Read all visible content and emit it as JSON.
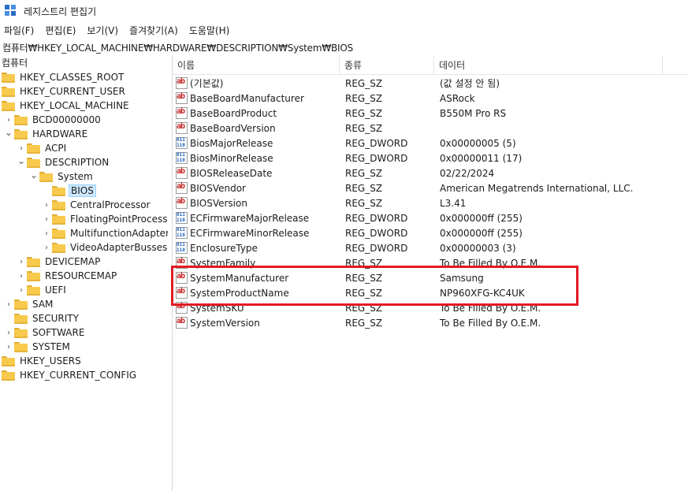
{
  "window": {
    "title": "레지스트리 편집기"
  },
  "menu": [
    "파일(F)",
    "편집(E)",
    "보기(V)",
    "즐겨찾기(A)",
    "도움말(H)"
  ],
  "address": "컴퓨터₩HKEY_LOCAL_MACHINE₩HARDWARE₩DESCRIPTION₩System₩BIOS",
  "tree": {
    "root": "컴퓨터",
    "nodes": [
      {
        "label": "HKEY_CLASSES_ROOT",
        "expander": ""
      },
      {
        "label": "HKEY_CURRENT_USER",
        "expander": ""
      },
      {
        "label": "HKEY_LOCAL_MACHINE",
        "expander": ""
      },
      {
        "label": "BCD00000000",
        "expander": ">"
      },
      {
        "label": "HARDWARE",
        "expander": "v"
      },
      {
        "label": "ACPI",
        "expander": ">"
      },
      {
        "label": "DESCRIPTION",
        "expander": "v"
      },
      {
        "label": "System",
        "expander": "v"
      },
      {
        "label": "BIOS",
        "expander": ""
      },
      {
        "label": "CentralProcessor",
        "expander": ">"
      },
      {
        "label": "FloatingPointProcessor",
        "expander": ">"
      },
      {
        "label": "MultifunctionAdapter",
        "expander": ">"
      },
      {
        "label": "VideoAdapterBusses",
        "expander": ">"
      },
      {
        "label": "DEVICEMAP",
        "expander": ">"
      },
      {
        "label": "RESOURCEMAP",
        "expander": ">"
      },
      {
        "label": "UEFI",
        "expander": ">"
      },
      {
        "label": "SAM",
        "expander": ">"
      },
      {
        "label": "SECURITY",
        "expander": ""
      },
      {
        "label": "SOFTWARE",
        "expander": ">"
      },
      {
        "label": "SYSTEM",
        "expander": ">"
      },
      {
        "label": "HKEY_USERS",
        "expander": ""
      },
      {
        "label": "HKEY_CURRENT_CONFIG",
        "expander": ""
      }
    ]
  },
  "columns": {
    "name": "이름",
    "type": "종류",
    "data": "데이터"
  },
  "values": [
    {
      "icon": "string-value-icon",
      "name": "(기본값)",
      "type": "REG_SZ",
      "data": "(값 설정 안 됨)"
    },
    {
      "icon": "string-value-icon",
      "name": "BaseBoardManufacturer",
      "type": "REG_SZ",
      "data": "ASRock"
    },
    {
      "icon": "string-value-icon",
      "name": "BaseBoardProduct",
      "type": "REG_SZ",
      "data": "B550M Pro RS"
    },
    {
      "icon": "string-value-icon",
      "name": "BaseBoardVersion",
      "type": "REG_SZ",
      "data": ""
    },
    {
      "icon": "dword-value-icon",
      "name": "BiosMajorRelease",
      "type": "REG_DWORD",
      "data": "0x00000005 (5)"
    },
    {
      "icon": "dword-value-icon",
      "name": "BiosMinorRelease",
      "type": "REG_DWORD",
      "data": "0x00000011 (17)"
    },
    {
      "icon": "string-value-icon",
      "name": "BIOSReleaseDate",
      "type": "REG_SZ",
      "data": "02/22/2024"
    },
    {
      "icon": "string-value-icon",
      "name": "BIOSVendor",
      "type": "REG_SZ",
      "data": "American Megatrends International, LLC."
    },
    {
      "icon": "string-value-icon",
      "name": "BIOSVersion",
      "type": "REG_SZ",
      "data": "L3.41"
    },
    {
      "icon": "dword-value-icon",
      "name": "ECFirmwareMajorRelease",
      "type": "REG_DWORD",
      "data": "0x000000ff (255)"
    },
    {
      "icon": "dword-value-icon",
      "name": "ECFirmwareMinorRelease",
      "type": "REG_DWORD",
      "data": "0x000000ff (255)"
    },
    {
      "icon": "dword-value-icon",
      "name": "EnclosureType",
      "type": "REG_DWORD",
      "data": "0x00000003 (3)"
    },
    {
      "icon": "string-value-icon",
      "name": "SystemFamily",
      "type": "REG_SZ",
      "data": "To Be Filled By O.E.M."
    },
    {
      "icon": "string-value-icon",
      "name": "SystemManufacturer",
      "type": "REG_SZ",
      "data": "Samsung"
    },
    {
      "icon": "string-value-icon",
      "name": "SystemProductName",
      "type": "REG_SZ",
      "data": "NP960XFG-KC4UK"
    },
    {
      "icon": "string-value-icon",
      "name": "SystemSKU",
      "type": "REG_SZ",
      "data": "To Be Filled By O.E.M."
    },
    {
      "icon": "string-value-icon",
      "name": "SystemVersion",
      "type": "REG_SZ",
      "data": "To Be Filled By O.E.M."
    }
  ],
  "colors": {
    "highlight": "#e01b24",
    "selection": "#cde8ff",
    "folder": "#f7c94c"
  }
}
